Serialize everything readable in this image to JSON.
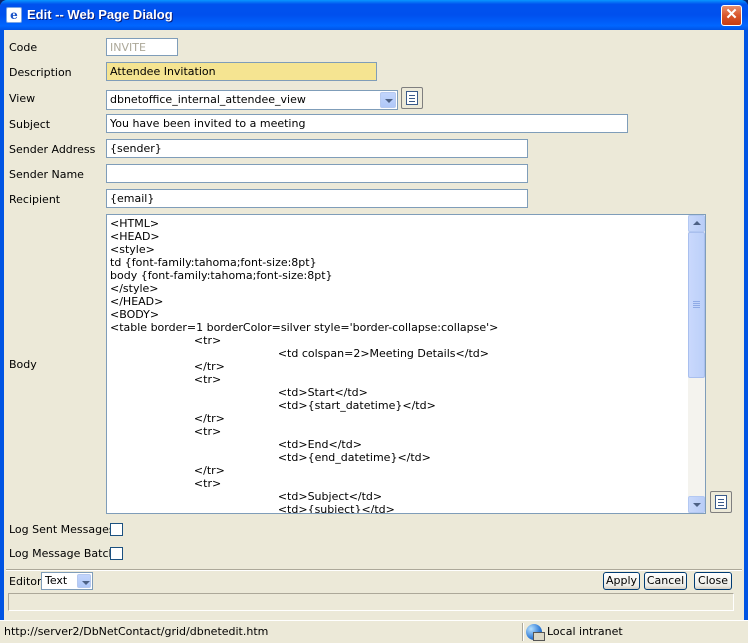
{
  "window": {
    "title": "Edit -- Web Page Dialog",
    "close_glyph": "✕"
  },
  "form": {
    "code": {
      "label": "Code",
      "value": "INVITE"
    },
    "description": {
      "label": "Description",
      "value": "Attendee Invitation"
    },
    "view": {
      "label": "View",
      "value": "dbnetoffice_internal_attendee_view"
    },
    "subject": {
      "label": "Subject",
      "value": "You have been invited to a meeting"
    },
    "sender_address": {
      "label": "Sender Address",
      "value": "{sender}"
    },
    "sender_name": {
      "label": "Sender Name",
      "value": ""
    },
    "recipient": {
      "label": "Recipient",
      "value": "{email}"
    },
    "body": {
      "label": "Body",
      "lines": [
        "<HTML>",
        "<HEAD>",
        "<style>",
        "td {font-family:tahoma;font-size:8pt}",
        "body {font-family:tahoma;font-size:8pt}",
        "</style>",
        "</HEAD>",
        "<BODY>",
        "<table border=1 borderColor=silver style='border-collapse:collapse'>",
        "\t\t\t<tr>",
        "\t\t\t\t\t\t<td colspan=2>Meeting Details</td>",
        "\t\t\t</tr>",
        "\t\t\t<tr>",
        "\t\t\t\t\t\t<td>Start</td>",
        "\t\t\t\t\t\t<td>{start_datetime}</td>",
        "\t\t\t</tr>",
        "\t\t\t<tr>",
        "\t\t\t\t\t\t<td>End</td>",
        "\t\t\t\t\t\t<td>{end_datetime}</td>",
        "\t\t\t</tr>",
        "\t\t\t<tr>",
        "\t\t\t\t\t\t<td>Subject</td>",
        "\t\t\t\t\t\t<td>{subject}</td>"
      ]
    },
    "log_sent_messages": {
      "label": "Log Sent Messages",
      "checked": false
    },
    "log_message_batch": {
      "label": "Log Message Batch",
      "checked": false
    }
  },
  "footer": {
    "editor_label": "Editor",
    "editor_value": "Text",
    "apply": "Apply",
    "cancel": "Cancel",
    "close": "Close"
  },
  "statusbar": {
    "url": "http://server2/DbNetContact/grid/dbnetedit.htm",
    "zone": "Local intranet"
  },
  "colors": {
    "title_bar": "#0054e3",
    "dialog_bg": "#ece9d8",
    "highlight_field": "#f5e491"
  }
}
